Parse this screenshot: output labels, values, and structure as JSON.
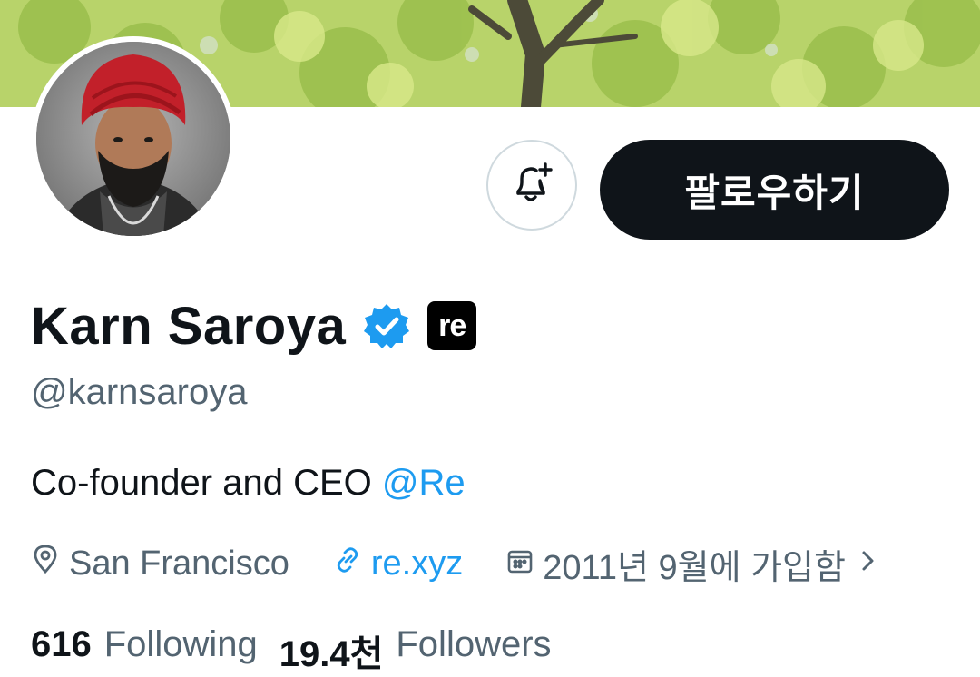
{
  "profile": {
    "display_name": "Karn Saroya",
    "handle": "@karnsaroya",
    "affiliation_badge": "re",
    "bio_text": "Co-founder and CEO ",
    "bio_mention": "@Re",
    "location": "San Francisco",
    "website": "re.xyz",
    "joined": "2011년 9월에 가입함"
  },
  "actions": {
    "follow_label": "팔로우하기"
  },
  "stats": {
    "following_count": "616",
    "following_label": "Following",
    "followers_count": "19.4천",
    "followers_label": "Followers"
  },
  "icons": {
    "notify": "bell-plus-icon",
    "verified": "verified-badge-icon",
    "location": "location-pin-icon",
    "link": "link-icon",
    "calendar": "calendar-icon",
    "chevron": "chevron-right-icon"
  },
  "colors": {
    "accent": "#1d9bf0",
    "text_primary": "#0f1419",
    "text_secondary": "#536471",
    "follow_button_bg": "#0f1419",
    "border": "#cfd9de"
  }
}
